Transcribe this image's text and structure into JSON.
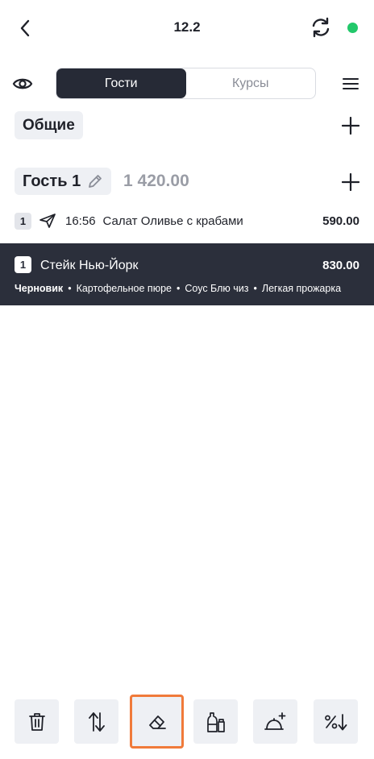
{
  "header": {
    "title": "12.2",
    "status_color": "#22c86a"
  },
  "tabs": [
    {
      "label": "Гости",
      "active": true
    },
    {
      "label": "Курсы",
      "active": false
    }
  ],
  "sections": {
    "general_label": "Общие",
    "guest": {
      "label": "Гость 1",
      "total": "1 420.00"
    }
  },
  "items": [
    {
      "qty": "1",
      "time": "16:56",
      "name": "Салат Оливье с крабами",
      "price": "590.00",
      "status_icon": "send-icon"
    },
    {
      "qty": "1",
      "name": "Стейк Нью-Йорк",
      "price": "830.00",
      "status": "Черновик",
      "modifiers": [
        "Картофельное пюре",
        "Соус Блю чиз",
        "Легкая прожарка"
      ],
      "selected": true
    }
  ],
  "bottom_bar": {
    "buttons": [
      "trash-icon",
      "sort-icon",
      "eraser-icon",
      "seasoning-icon",
      "add-dish-icon",
      "discount-icon"
    ],
    "highlighted": "eraser-icon",
    "highlight_color": "#f07a3a"
  }
}
